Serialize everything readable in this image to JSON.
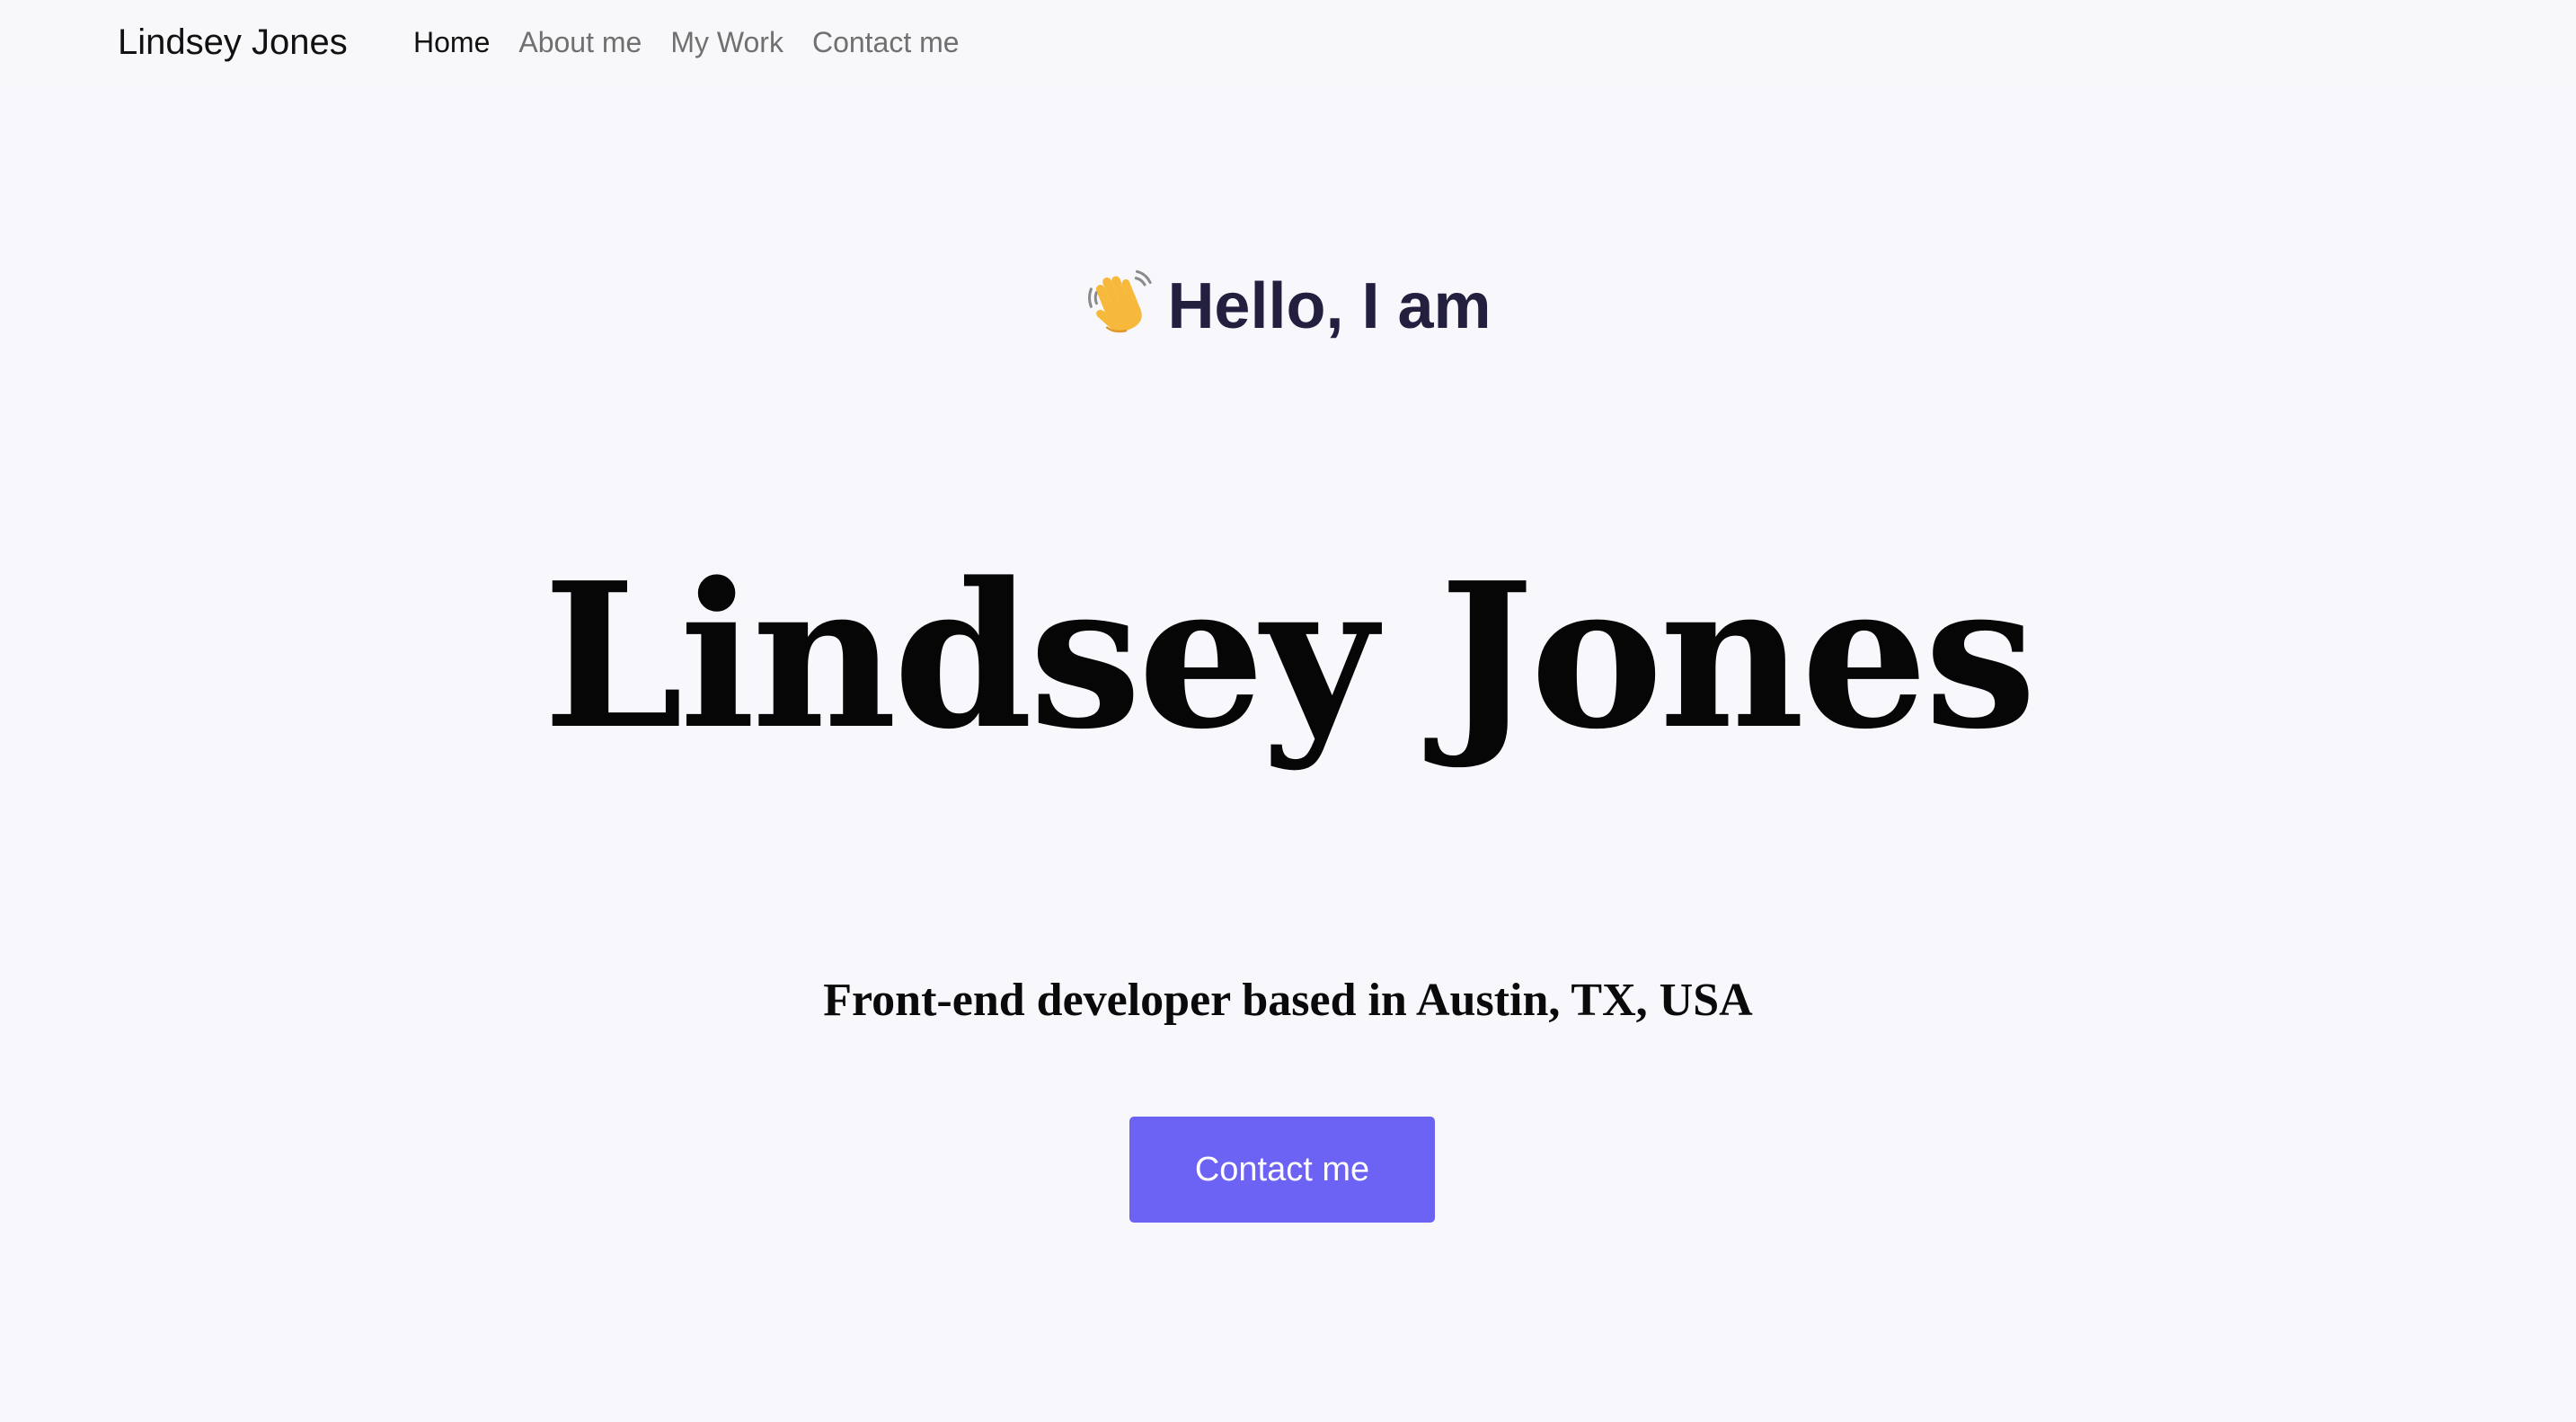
{
  "navbar": {
    "brand": "Lindsey Jones",
    "links": [
      {
        "label": "Home",
        "active": true
      },
      {
        "label": "About me",
        "active": false
      },
      {
        "label": "My Work",
        "active": false
      },
      {
        "label": "Contact me",
        "active": false
      }
    ]
  },
  "hero": {
    "greeting_icon": "waving-hand-icon",
    "greeting": "Hello, I am",
    "name": "Lindsey Jones",
    "tagline": "Front-end developer based in Austin, TX, USA",
    "cta_label": "Contact me"
  },
  "colors": {
    "background": "#f8f7fc",
    "accent": "#6c63f5",
    "greeting_text": "#23203f",
    "nav_inactive": "#707070"
  }
}
